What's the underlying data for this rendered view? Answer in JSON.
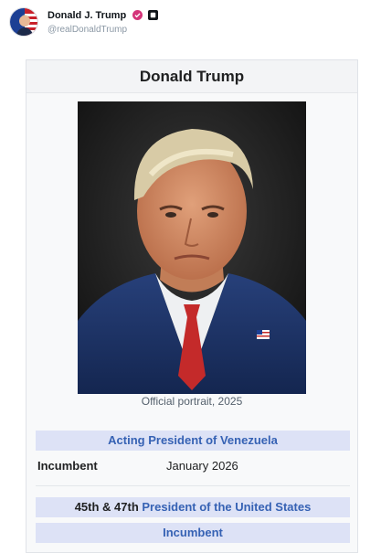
{
  "post": {
    "author_name": "Donald J. Trump",
    "author_handle": "@realDonaldTrump",
    "avatar_icon": "avatar-icon",
    "verified_icon": "verified-badge-icon",
    "badge_color": "#d4347a"
  },
  "infobox": {
    "title": "Donald Trump",
    "portrait_caption": "Official portrait, 2025",
    "office_1": {
      "title": "Acting President of Venezuela",
      "incumbent_label": "Incumbent",
      "incumbent_since": "January 2026"
    },
    "office_2": {
      "prefix": "45th & 47th ",
      "title": "President of the United States",
      "status": "Incumbent"
    },
    "colors": {
      "header_bg": "#dde2f6",
      "link": "#3662b4",
      "box_bg": "#f8f9fa"
    }
  }
}
